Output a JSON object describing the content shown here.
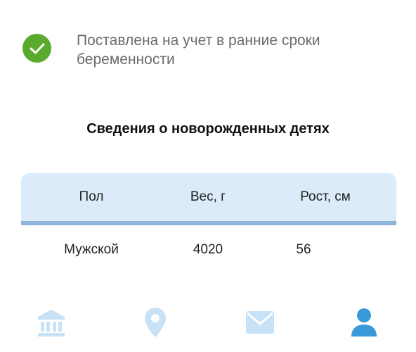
{
  "status": {
    "text": "Поставлена на учет в ранние сроки беременности",
    "icon": "check-circle-icon",
    "color": "#5aaa2e"
  },
  "newborns": {
    "title": "Сведения о новорожденных детях",
    "columns": [
      "Пол",
      "Вес, г",
      "Рост, см"
    ],
    "rows": [
      [
        "Мужской",
        "4020",
        "56"
      ]
    ],
    "header_bg": "#dcebf9",
    "header_line": "#8fb4dc"
  },
  "nav": {
    "items": [
      {
        "icon": "institution-icon",
        "active": false
      },
      {
        "icon": "location-pin-icon",
        "active": false
      },
      {
        "icon": "mail-icon",
        "active": false
      },
      {
        "icon": "user-icon",
        "active": true
      }
    ],
    "inactive_color": "#c7e1f6",
    "active_color": "#3a9ad9"
  }
}
